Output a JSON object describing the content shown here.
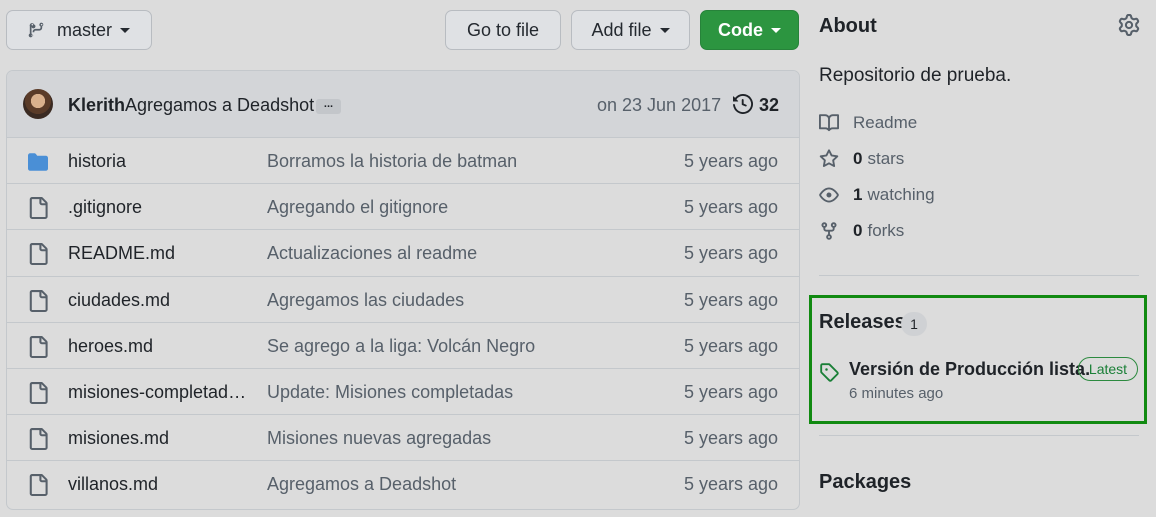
{
  "toolbar": {
    "branch": "master",
    "go_to_file": "Go to file",
    "add_file": "Add file",
    "code": "Code"
  },
  "commit": {
    "author": "Klerith",
    "message": "Agregamos a Deadshot",
    "ellipsis": "...",
    "date": "on 23 Jun 2017",
    "count": "32"
  },
  "files": [
    {
      "type": "folder",
      "name": "historia",
      "commit": "Borramos la historia de batman",
      "age": "5 years ago"
    },
    {
      "type": "file",
      "name": ".gitignore",
      "commit": "Agregando el gitignore",
      "age": "5 years ago"
    },
    {
      "type": "file",
      "name": "README.md",
      "commit": "Actualizaciones al readme",
      "age": "5 years ago"
    },
    {
      "type": "file",
      "name": "ciudades.md",
      "commit": "Agregamos las ciudades",
      "age": "5 years ago"
    },
    {
      "type": "file",
      "name": "heroes.md",
      "commit": "Se agrego a la liga: Volcán Negro",
      "age": "5 years ago"
    },
    {
      "type": "file",
      "name": "misiones-completada...",
      "commit": "Update: Misiones completadas",
      "age": "5 years ago"
    },
    {
      "type": "file",
      "name": "misiones.md",
      "commit": "Misiones nuevas agregadas",
      "age": "5 years ago"
    },
    {
      "type": "file",
      "name": "villanos.md",
      "commit": "Agregamos a Deadshot",
      "age": "5 years ago"
    }
  ],
  "about": {
    "title": "About",
    "description": "Repositorio de prueba.",
    "readme": "Readme",
    "stars_count": "0",
    "stars_label": "stars",
    "watching_count": "1",
    "watching_label": "watching",
    "forks_count": "0",
    "forks_label": "forks"
  },
  "releases": {
    "title": "Releases",
    "count": "1",
    "name": "Versión de Producción lista.",
    "badge": "Latest",
    "time": "6 minutes ago"
  },
  "packages": {
    "title": "Packages"
  },
  "colors": {
    "accent_green": "#2c9540",
    "highlight_box": "#118a11",
    "folder_blue": "#4a8fd6"
  }
}
